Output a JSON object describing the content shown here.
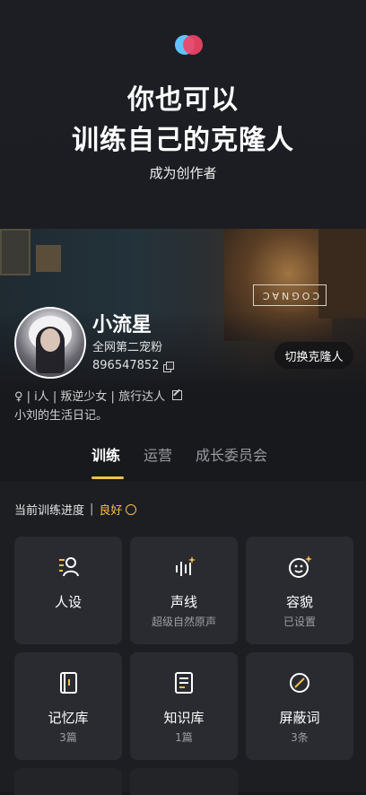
{
  "hero": {
    "line1": "你也可以",
    "line2": "训练自己的克隆人",
    "subtitle": "成为创作者"
  },
  "banner": {
    "sign_text": "COGNAC"
  },
  "profile": {
    "name": "小流星",
    "fans": "全网第二宠粉",
    "uid": "896547852",
    "switch_label": "切换克隆人",
    "tags": "♀ | i人 | 叛逆少女 | 旅行达人",
    "bio": "小刘的生活日记。"
  },
  "tabs": [
    {
      "label": "训练"
    },
    {
      "label": "运营"
    },
    {
      "label": "成长委员会"
    }
  ],
  "progress": {
    "label": "当前训练进度",
    "sep": "|",
    "value": "良好"
  },
  "cards": [
    {
      "title": "人设",
      "sub": "",
      "icon": "persona-icon"
    },
    {
      "title": "声线",
      "sub": "超级自然原声",
      "icon": "voice-icon"
    },
    {
      "title": "容貌",
      "sub": "已设置",
      "icon": "face-icon"
    },
    {
      "title": "记忆库",
      "sub": "3篇",
      "icon": "memory-icon"
    },
    {
      "title": "知识库",
      "sub": "1篇",
      "icon": "knowledge-icon"
    },
    {
      "title": "屏蔽词",
      "sub": "3条",
      "icon": "block-icon"
    }
  ],
  "colors": {
    "accent": "#f5c24a",
    "background": "#18191d",
    "card": "#2a2b30"
  }
}
